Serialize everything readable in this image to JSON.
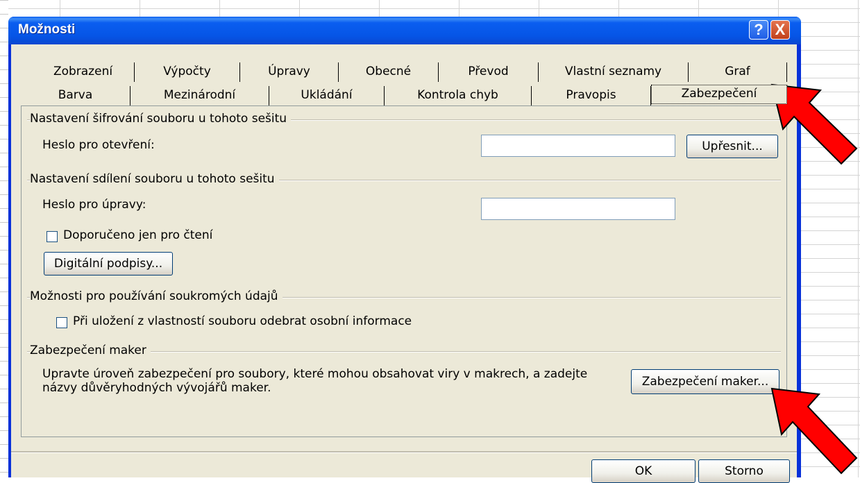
{
  "window": {
    "title": "Možnosti",
    "help_label": "?",
    "close_label": "X"
  },
  "tabs_row1": [
    "Zobrazení",
    "Výpočty",
    "Úpravy",
    "Obecné",
    "Převod",
    "Vlastní seznamy",
    "Graf"
  ],
  "tabs_row2": [
    "Barva",
    "Mezinárodní",
    "Ukládání",
    "Kontrola chyb",
    "Pravopis",
    "Zabezpečení"
  ],
  "active_tab": "Zabezpečení",
  "encryption": {
    "title": "Nastavení šifrování souboru u tohoto sešitu",
    "open_password_label": "Heslo pro otevření:",
    "open_password_value": "",
    "advanced_button": "Upřesnit..."
  },
  "sharing": {
    "title": "Nastavení sdílení souboru u tohoto sešitu",
    "modify_password_label": "Heslo pro úpravy:",
    "modify_password_value": "",
    "readonly_label": "Doporučeno jen pro čtení",
    "digital_signatures_button": "Digitální podpisy..."
  },
  "privacy": {
    "title": "Možnosti pro používání soukromých údajů",
    "remove_info_label": "Při uložení z vlastností souboru odebrat osobní informace"
  },
  "macro": {
    "title": "Zabezpečení maker",
    "description": "Upravte úroveň zabezpečení pro soubory, které mohou obsahovat viry v makrech, a zadejte názvy důvěryhodných vývojářů maker.",
    "button": "Zabezpečení maker..."
  },
  "footer": {
    "ok": "OK",
    "cancel": "Storno"
  },
  "colors": {
    "title_bar": "#0a5ef0",
    "dialog_face": "#ece9d8",
    "annotation_arrow": "#ff0000"
  }
}
